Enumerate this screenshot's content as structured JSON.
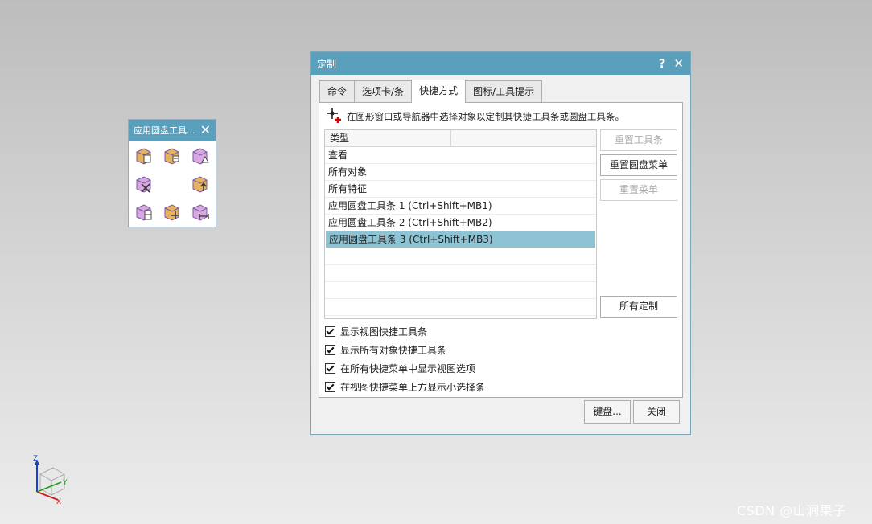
{
  "radial_toolbar": {
    "title": "应用圆盘工具...",
    "tools": [
      {
        "icon": "box-copy-icon"
      },
      {
        "icon": "box-rotate-icon"
      },
      {
        "icon": "box-triangle-icon"
      },
      {
        "icon": "box-delete-icon"
      },
      {
        "icon": "box-up-arrow-icon"
      },
      {
        "icon": "box-split-icon"
      },
      {
        "icon": "box-move-icon"
      },
      {
        "icon": "box-measure-icon"
      }
    ]
  },
  "dialog": {
    "title": "定制",
    "help_label": "?",
    "close_label": "✕",
    "tabs": [
      "命令",
      "选项卡/条",
      "快捷方式",
      "图标/工具提示"
    ],
    "active_tab": 2,
    "hint": "在图形窗口或导航器中选择对象以定制其快捷工具条或圆盘工具条。",
    "list": {
      "header": "类型",
      "rows": [
        "查看",
        "所有对象",
        "所有特征",
        "应用圆盘工具条 1 (Ctrl+Shift+MB1)",
        "应用圆盘工具条 2 (Ctrl+Shift+MB2)",
        "应用圆盘工具条 3 (Ctrl+Shift+MB3)"
      ],
      "selected_index": 5
    },
    "side_buttons": {
      "reset_toolbar": "重置工具条",
      "reset_radial": "重置圆盘菜单",
      "reset_menu": "重置菜单",
      "all_custom": "所有定制"
    },
    "checkboxes": [
      {
        "label": "显示视图快捷工具条",
        "checked": true
      },
      {
        "label": "显示所有对象快捷工具条",
        "checked": true
      },
      {
        "label": "在所有快捷菜单中显示视图选项",
        "checked": true
      },
      {
        "label": "在视图快捷菜单上方显示小选择条",
        "checked": true
      }
    ],
    "footer": {
      "keyboard": "键盘...",
      "close": "关闭"
    }
  },
  "triad": {
    "z": "Z",
    "y": "Y",
    "x": "X"
  },
  "watermark": "CSDN @山涧果子",
  "colors": {
    "titlebar": "#5aa0bd",
    "selection": "#8ec3d3"
  }
}
